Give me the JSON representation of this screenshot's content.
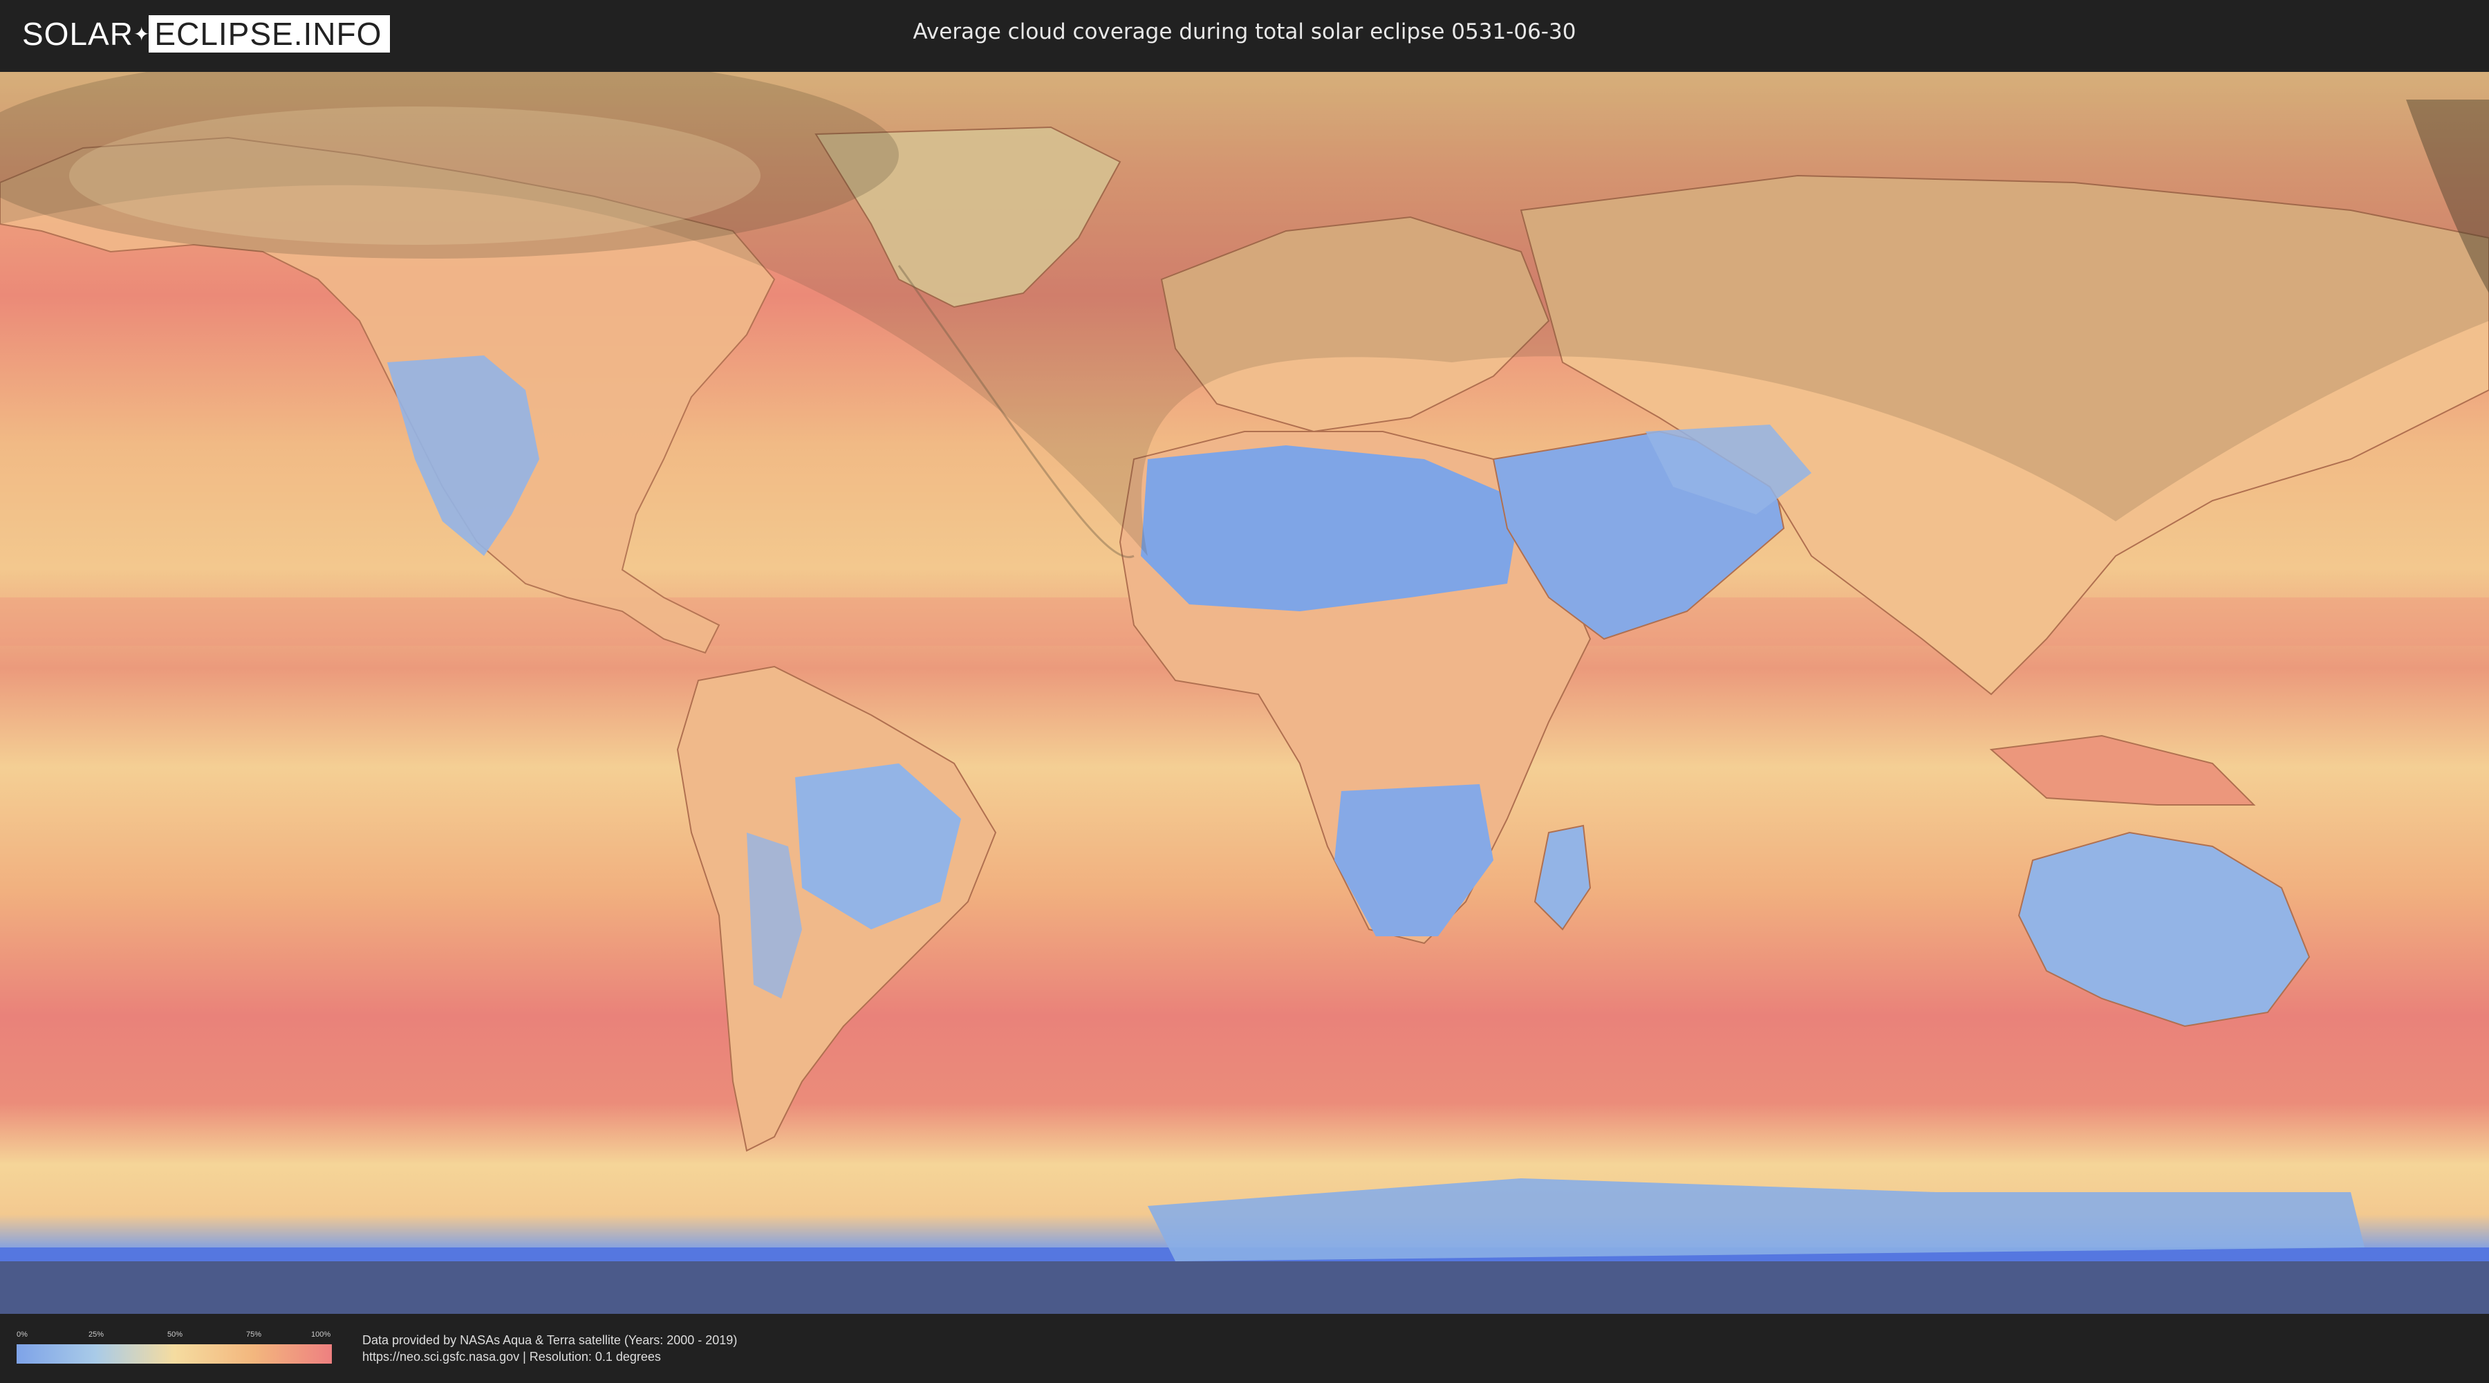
{
  "header": {
    "logo_left": "SOLAR",
    "logo_right": "ECLIPSE.INFO",
    "title": "Average cloud coverage during total solar eclipse 0531-06-30"
  },
  "legend": {
    "ticks": [
      "0%",
      "25%",
      "50%",
      "75%",
      "100%"
    ],
    "colors": [
      "#7ea3e8",
      "#a9cbe8",
      "#f5dca0",
      "#f3b77e",
      "#ee8080"
    ]
  },
  "attribution": {
    "line1": "Data provided by NASAs Aqua & Terra satellite (Years: 2000 - 2019)",
    "line2": "https://neo.sci.gsfc.nasa.gov | Resolution: 0.1 degrees"
  },
  "map": {
    "ocean_color": "#f0b27e",
    "cloudy_color": "#eb8a78",
    "clear_color": "#8cb0e6",
    "shadow_color": "#4a3f2a"
  }
}
